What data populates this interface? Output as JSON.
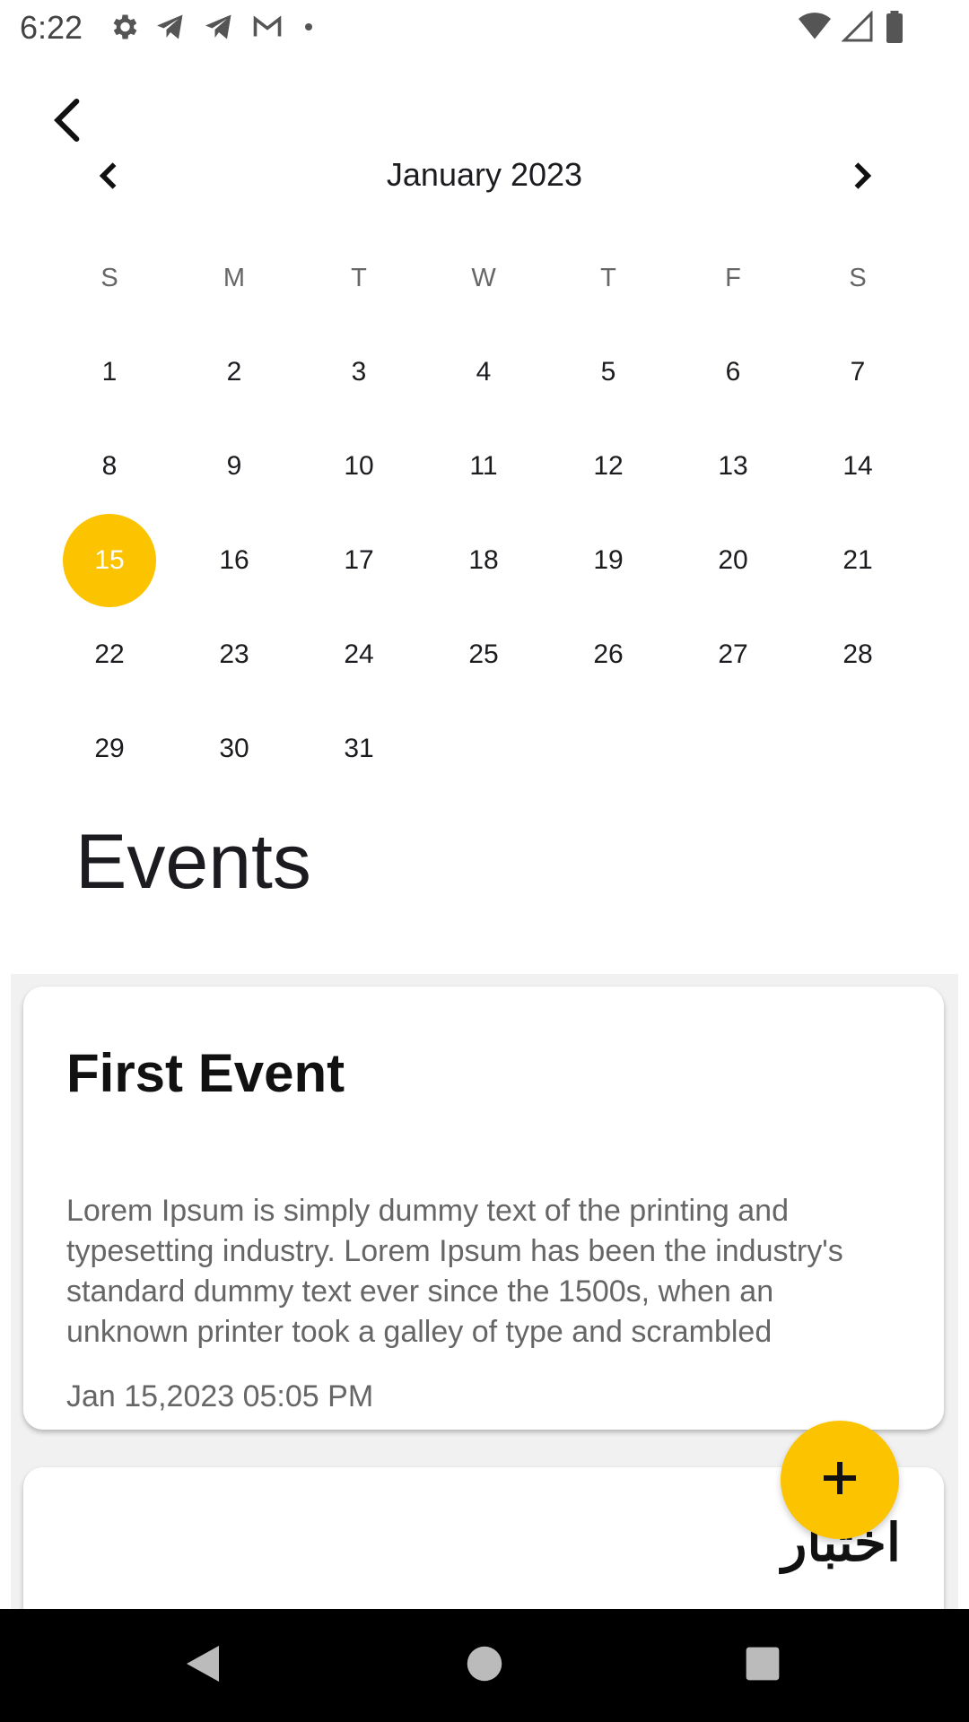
{
  "status_bar": {
    "time": "6:22",
    "left_icons": [
      "gear-icon",
      "telegram-icon",
      "telegram-icon",
      "gmail-icon",
      "dot-icon"
    ],
    "right_icons": [
      "wifi-icon",
      "signal-icon",
      "battery-icon"
    ]
  },
  "calendar": {
    "month_label": "January 2023",
    "weekdays": [
      "S",
      "M",
      "T",
      "W",
      "T",
      "F",
      "S"
    ],
    "first_weekday_index": 0,
    "days_in_month": 31,
    "selected_day": "15",
    "accent_color": "#fbc300"
  },
  "events_title": "Events",
  "events": [
    {
      "title": "First Event",
      "description": "Lorem Ipsum is simply dummy text of the printing and typesetting industry. Lorem Ipsum has been the industry's standard dummy text ever since the 1500s, when an unknown printer took a galley of type and scrambled",
      "datetime": "Jan 15,2023  05:05 PM"
    },
    {
      "title": "اختبار"
    }
  ],
  "fab": {
    "icon": "plus-icon",
    "color": "#fbc300"
  },
  "nav_bar": {
    "buttons": [
      "back-triangle-icon",
      "home-circle-icon",
      "recents-square-icon"
    ]
  }
}
